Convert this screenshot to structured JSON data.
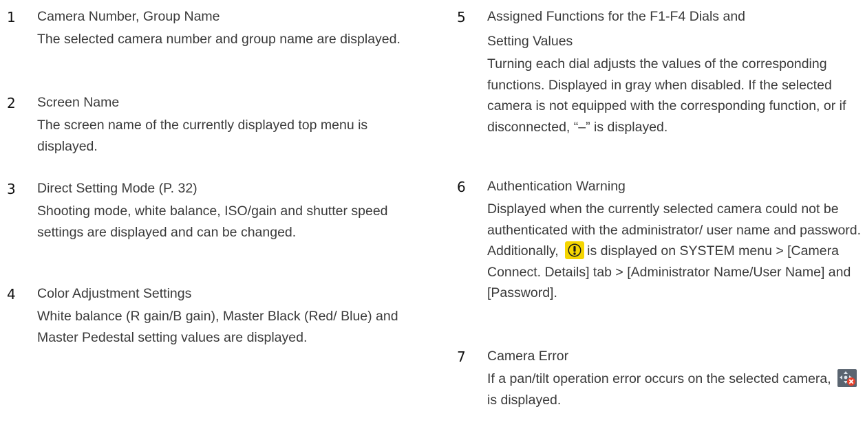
{
  "left_items": [
    {
      "number": "1",
      "title": "Camera Number, Group Name",
      "description": "The selected camera number and group name are displayed."
    },
    {
      "number": "2",
      "title": "Screen Name",
      "description": "The screen name of the currently displayed top menu is displayed."
    },
    {
      "number": "3",
      "title": "Direct Setting Mode (P. 32)",
      "description": "Shooting mode, white balance, ISO/gain and shutter speed settings are displayed and can be changed."
    },
    {
      "number": "4",
      "title": "Color Adjustment Settings",
      "description": "White balance (R gain/B gain), Master Black (Red/ Blue) and Master Pedestal setting values are displayed."
    }
  ],
  "right_items": [
    {
      "number": "5",
      "title": "Assigned Functions for the F1-F4 Dials and Setting Values",
      "description": "Turning each dial adjusts the values of the corresponding functions. Displayed in gray when disabled. If the selected camera is not equipped with the corresponding function, or if disconnected, “–” is displayed."
    },
    {
      "number": "6",
      "title": "Authentication Warning",
      "description_before_icon": "Displayed when the currently selected camera could not be authenticated with the administrator/ user name and password. Additionally,",
      "description_after_icon": "is displayed on SYSTEM menu > [Camera Connect. Details] tab > [Administrator Name/User Name] and [Password].",
      "icon": "warning-icon"
    },
    {
      "number": "7",
      "title": "Camera Error",
      "description_before_icon": "If a pan/tilt operation error occurs on the selected camera,",
      "description_after_icon": "is displayed.",
      "icon": "pan-tilt-error-icon"
    }
  ],
  "colors": {
    "text": "#3a3a3a",
    "number": "#111111",
    "warning_fill": "#f5d500",
    "error_badge": "#e8402a"
  }
}
